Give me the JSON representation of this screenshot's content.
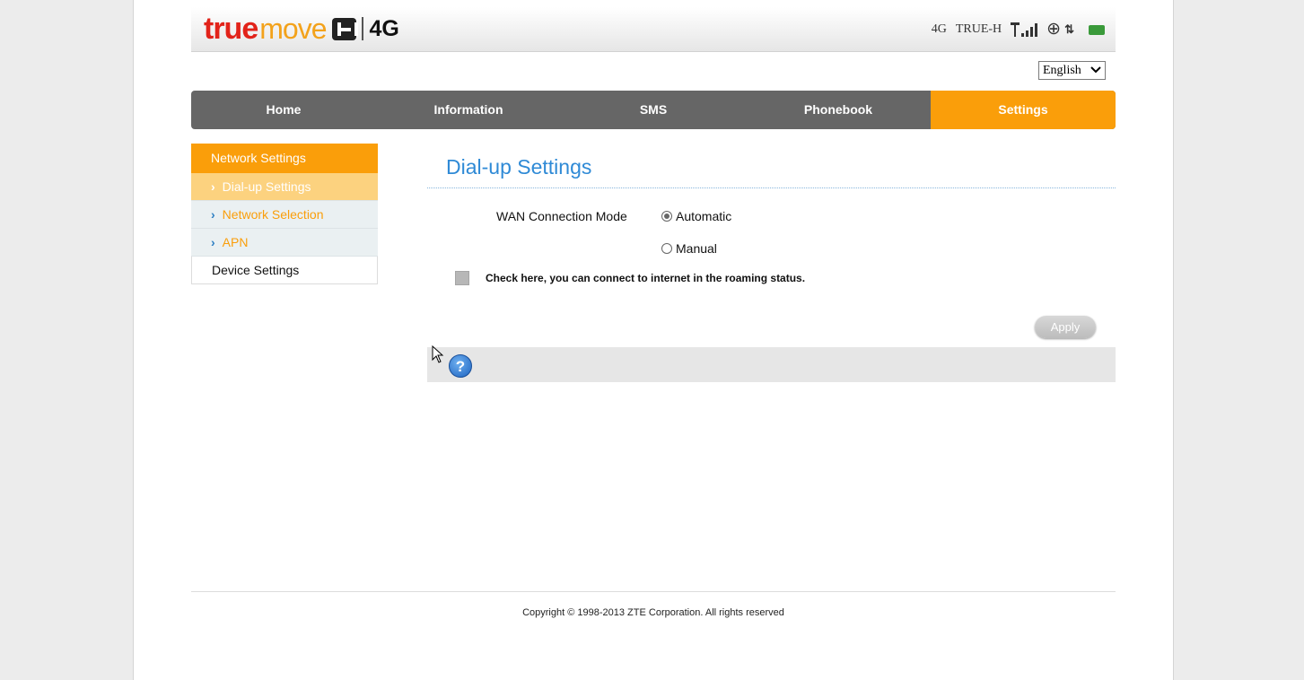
{
  "header": {
    "logo": {
      "true": "true",
      "move": "move",
      "h": "H",
      "network": "4G"
    },
    "status": {
      "network_type": "4G",
      "operator": "TRUE-H"
    }
  },
  "language": {
    "selected": "English"
  },
  "nav": {
    "items": [
      {
        "label": "Home"
      },
      {
        "label": "Information"
      },
      {
        "label": "SMS"
      },
      {
        "label": "Phonebook"
      },
      {
        "label": "Settings"
      }
    ],
    "active": "Settings"
  },
  "sidebar": {
    "network_settings": "Network Settings",
    "sub_items": [
      {
        "label": "Dial-up Settings",
        "active": true
      },
      {
        "label": "Network Selection",
        "active": false
      },
      {
        "label": "APN",
        "active": false
      }
    ],
    "device_settings": "Device Settings"
  },
  "main": {
    "title": "Dial-up Settings",
    "wan_label": "WAN Connection Mode",
    "options": [
      {
        "label": "Automatic",
        "checked": true
      },
      {
        "label": "Manual",
        "checked": false
      }
    ],
    "roaming_text": "Check here, you can connect to internet in the roaming status.",
    "apply_label": "Apply"
  },
  "footer": {
    "copyright": "Copyright © 1998-2013 ZTE Corporation. All rights reserved"
  },
  "colors": {
    "accent": "#fa9e0a",
    "nav_bg": "#666666",
    "title_blue": "#2f8ad6",
    "link_blue": "#2e7fc3"
  }
}
